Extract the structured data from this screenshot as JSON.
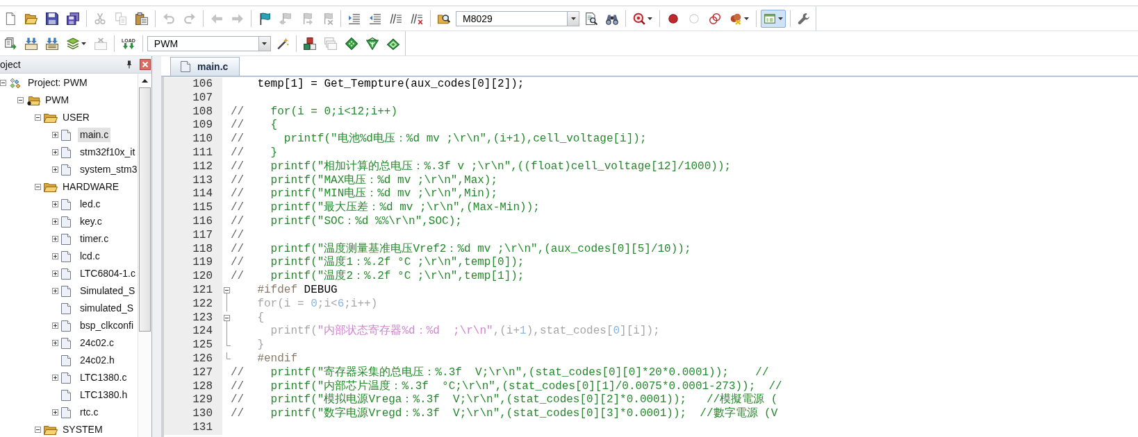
{
  "toolbars": [
    {
      "items": [
        {
          "kind": "new",
          "disabled": false,
          "pressed": false
        },
        {
          "kind": "open",
          "disabled": false,
          "pressed": false
        },
        {
          "kind": "save",
          "disabled": false,
          "pressed": false
        },
        {
          "kind": "saveall",
          "disabled": false,
          "pressed": false
        },
        {
          "kind": "sep"
        },
        {
          "kind": "cut",
          "disabled": true,
          "pressed": false
        },
        {
          "kind": "copy",
          "disabled": true,
          "pressed": false
        },
        {
          "kind": "paste",
          "disabled": false,
          "pressed": false
        },
        {
          "kind": "sep"
        },
        {
          "kind": "undo",
          "disabled": true,
          "pressed": false
        },
        {
          "kind": "redo",
          "disabled": true,
          "pressed": false
        },
        {
          "kind": "sep"
        },
        {
          "kind": "back",
          "disabled": true,
          "pressed": false
        },
        {
          "kind": "forward",
          "disabled": true,
          "pressed": false
        },
        {
          "kind": "sep"
        },
        {
          "kind": "bookmark",
          "disabled": false,
          "pressed": false
        },
        {
          "kind": "prevmark",
          "disabled": true,
          "pressed": false
        },
        {
          "kind": "nextmark",
          "disabled": true,
          "pressed": false
        },
        {
          "kind": "clearmarks",
          "disabled": true,
          "pressed": false
        },
        {
          "kind": "sep"
        },
        {
          "kind": "indent",
          "disabled": false,
          "pressed": false
        },
        {
          "kind": "outdent",
          "disabled": false,
          "pressed": false
        },
        {
          "kind": "comment",
          "disabled": false,
          "pressed": false
        },
        {
          "kind": "uncomment",
          "disabled": false,
          "pressed": false
        },
        {
          "kind": "sep"
        },
        {
          "kind": "findfiles",
          "disabled": false,
          "pressed": false
        },
        {
          "kind": "combo",
          "value": "M8029"
        },
        {
          "kind": "find",
          "disabled": false,
          "pressed": false
        },
        {
          "kind": "incfind",
          "disabled": false,
          "pressed": false
        },
        {
          "kind": "sep"
        },
        {
          "kind": "debug",
          "disabled": false,
          "pressed": false,
          "menu": true
        },
        {
          "kind": "sep"
        },
        {
          "kind": "breakpoint",
          "disabled": false,
          "pressed": false
        },
        {
          "kind": "bpdisable",
          "disabled": true,
          "pressed": false
        },
        {
          "kind": "bpdisableall",
          "disabled": false,
          "pressed": false
        },
        {
          "kind": "bpkillall",
          "disabled": false,
          "pressed": false,
          "menu": true
        },
        {
          "kind": "sep"
        },
        {
          "kind": "windows",
          "disabled": false,
          "pressed": true,
          "menu": true
        },
        {
          "kind": "sep"
        },
        {
          "kind": "config",
          "disabled": false,
          "pressed": false
        }
      ]
    },
    {
      "items": [
        {
          "kind": "translate",
          "disabled": false,
          "pressed": false
        },
        {
          "kind": "build",
          "disabled": false,
          "pressed": false
        },
        {
          "kind": "rebuild",
          "disabled": false,
          "pressed": false
        },
        {
          "kind": "batch",
          "disabled": false,
          "pressed": false,
          "menu": true
        },
        {
          "kind": "stop",
          "disabled": true,
          "pressed": false
        },
        {
          "kind": "sep"
        },
        {
          "kind": "download",
          "disabled": false,
          "pressed": false,
          "label": "LOAD"
        },
        {
          "kind": "sep"
        },
        {
          "kind": "combo",
          "value": "PWM"
        },
        {
          "kind": "options",
          "disabled": false,
          "pressed": false
        },
        {
          "kind": "sep"
        },
        {
          "kind": "components",
          "disabled": false,
          "pressed": false
        },
        {
          "kind": "packs",
          "disabled": true,
          "pressed": false
        },
        {
          "kind": "select",
          "disabled": false,
          "pressed": false
        },
        {
          "kind": "fork",
          "disabled": false,
          "pressed": false
        },
        {
          "kind": "stack",
          "disabled": false,
          "pressed": false
        }
      ]
    }
  ],
  "project_panel": {
    "title": "oject",
    "tree": [
      {
        "label": "Project: PWM",
        "kind": "project",
        "expanded": true,
        "selected": false,
        "children": [
          {
            "label": "PWM",
            "kind": "target",
            "expanded": true,
            "selected": false,
            "children": [
              {
                "label": "USER",
                "kind": "group",
                "expanded": true,
                "selected": false,
                "children": [
                  {
                    "label": "main.c",
                    "kind": "file",
                    "expanded": false,
                    "selected": true
                  },
                  {
                    "label": "stm32f10x_it",
                    "kind": "file",
                    "expanded": false,
                    "selected": false
                  },
                  {
                    "label": "system_stm3",
                    "kind": "file",
                    "expanded": false,
                    "selected": false
                  }
                ]
              },
              {
                "label": "HARDWARE",
                "kind": "group",
                "expanded": true,
                "selected": false,
                "children": [
                  {
                    "label": "led.c",
                    "kind": "file",
                    "expanded": false,
                    "selected": false
                  },
                  {
                    "label": "key.c",
                    "kind": "file",
                    "expanded": false,
                    "selected": false
                  },
                  {
                    "label": "timer.c",
                    "kind": "file",
                    "expanded": false,
                    "selected": false
                  },
                  {
                    "label": "lcd.c",
                    "kind": "file",
                    "expanded": false,
                    "selected": false
                  },
                  {
                    "label": "LTC6804-1.c",
                    "kind": "file",
                    "expanded": false,
                    "selected": false
                  },
                  {
                    "label": "Simulated_S",
                    "kind": "file",
                    "expanded": false,
                    "selected": false
                  },
                  {
                    "label": "simulated_S",
                    "kind": "file",
                    "selected": false
                  },
                  {
                    "label": "bsp_clkconfi",
                    "kind": "file",
                    "expanded": false,
                    "selected": false
                  },
                  {
                    "label": "24c02.c",
                    "kind": "file",
                    "expanded": false,
                    "selected": false
                  },
                  {
                    "label": "24c02.h",
                    "kind": "file",
                    "selected": false
                  },
                  {
                    "label": "LTC1380.c",
                    "kind": "file",
                    "expanded": false,
                    "selected": false
                  },
                  {
                    "label": "LTC1380.h",
                    "kind": "file",
                    "selected": false
                  },
                  {
                    "label": "rtc.c",
                    "kind": "file",
                    "expanded": false,
                    "selected": false
                  }
                ]
              },
              {
                "label": "SYSTEM",
                "kind": "group",
                "expanded": true,
                "selected": false
              }
            ]
          }
        ]
      }
    ]
  },
  "editor": {
    "tabs": [
      {
        "label": "main.c",
        "selected": true
      }
    ],
    "lines": [
      {
        "number": "106",
        "kind": "code",
        "segments": [
          {
            "kind": "plain",
            "text": "    temp[1] = Get_Tempture(aux_codes[0][2]);"
          }
        ]
      },
      {
        "number": "107",
        "kind": "code"
      },
      {
        "number": "108",
        "kind": "code",
        "segments": [
          {
            "kind": "mark",
            "text": "//"
          },
          {
            "kind": "comment",
            "text": "    for(i = 0;i<12;i++)"
          }
        ]
      },
      {
        "number": "109",
        "kind": "code",
        "segments": [
          {
            "kind": "mark",
            "text": "//"
          },
          {
            "kind": "comment",
            "text": "    {"
          }
        ]
      },
      {
        "number": "110",
        "kind": "code",
        "segments": [
          {
            "kind": "mark",
            "text": "//"
          },
          {
            "kind": "comment",
            "text": "      printf(\"电池%d电压：%d mv ;\\r\\n\",(i+1),cell_voltage[i]);"
          }
        ]
      },
      {
        "number": "111",
        "kind": "code",
        "segments": [
          {
            "kind": "mark",
            "text": "//"
          },
          {
            "kind": "comment",
            "text": "    }"
          }
        ]
      },
      {
        "number": "112",
        "kind": "code",
        "segments": [
          {
            "kind": "mark",
            "text": "//"
          },
          {
            "kind": "comment",
            "text": "    printf(\"相加计算的总电压：%.3f v ;\\r\\n\",((float)cell_voltage[12]/1000));"
          }
        ]
      },
      {
        "number": "113",
        "kind": "code",
        "segments": [
          {
            "kind": "mark",
            "text": "//"
          },
          {
            "kind": "comment",
            "text": "    printf(\"MAX电压：%d mv ;\\r\\n\",Max);"
          }
        ]
      },
      {
        "number": "114",
        "kind": "code",
        "segments": [
          {
            "kind": "mark",
            "text": "//"
          },
          {
            "kind": "comment",
            "text": "    printf(\"MIN电压：%d mv ;\\r\\n\",Min);"
          }
        ]
      },
      {
        "number": "115",
        "kind": "code",
        "segments": [
          {
            "kind": "mark",
            "text": "//"
          },
          {
            "kind": "comment",
            "text": "    printf(\"最大压差：%d mv ;\\r\\n\",(Max-Min));"
          }
        ]
      },
      {
        "number": "116",
        "kind": "code",
        "segments": [
          {
            "kind": "mark",
            "text": "//"
          },
          {
            "kind": "comment",
            "text": "    printf(\"SOC：%d %%\\r\\n\",SOC);"
          }
        ]
      },
      {
        "number": "117",
        "kind": "code",
        "segments": [
          {
            "kind": "mark",
            "text": "//"
          }
        ]
      },
      {
        "number": "118",
        "kind": "code",
        "segments": [
          {
            "kind": "mark",
            "text": "//"
          },
          {
            "kind": "comment",
            "text": "    printf(\"温度测量基准电压Vref2：%d mv ;\\r\\n\",(aux_codes[0][5]/10));"
          }
        ]
      },
      {
        "number": "119",
        "kind": "code",
        "segments": [
          {
            "kind": "mark",
            "text": "//"
          },
          {
            "kind": "comment",
            "text": "    printf(\"温度1：%.2f °C ;\\r\\n\",temp[0]);"
          }
        ]
      },
      {
        "number": "120",
        "kind": "code",
        "segments": [
          {
            "kind": "mark",
            "text": "//"
          },
          {
            "kind": "comment",
            "text": "    printf(\"温度2：%.2f °C ;\\r\\n\",temp[1]);"
          }
        ]
      },
      {
        "number": "121",
        "kind": "foldstart",
        "expanded": true,
        "segments": [
          {
            "kind": "directive",
            "text": "    #ifdef"
          },
          {
            "kind": "plain",
            "text": " DEBUG"
          }
        ]
      },
      {
        "number": "122",
        "kind": "foldbody",
        "segments": [
          {
            "kind": "inactive",
            "text": "    for(i = "
          },
          {
            "kind": "number",
            "text": "0"
          },
          {
            "kind": "inactive",
            "text": ";i<"
          },
          {
            "kind": "number",
            "text": "6"
          },
          {
            "kind": "inactive",
            "text": ";i++)"
          }
        ]
      },
      {
        "number": "123",
        "kind": "foldstart",
        "expanded": true,
        "segments": [
          {
            "kind": "inactive",
            "text": "    {"
          }
        ]
      },
      {
        "number": "124",
        "kind": "foldbody",
        "segments": [
          {
            "kind": "inactive",
            "text": "      printf("
          },
          {
            "kind": "string",
            "text": "\"内部状态寄存器%d：%d  ;\\r\\n\""
          },
          {
            "kind": "inactive",
            "text": ",(i+"
          },
          {
            "kind": "number",
            "text": "1"
          },
          {
            "kind": "inactive",
            "text": "),stat_codes["
          },
          {
            "kind": "number",
            "text": "0"
          },
          {
            "kind": "inactive",
            "text": "][i]);"
          }
        ]
      },
      {
        "number": "125",
        "kind": "foldend",
        "segments": [
          {
            "kind": "inactive",
            "text": "    }"
          }
        ]
      },
      {
        "number": "126",
        "kind": "foldend",
        "segments": [
          {
            "kind": "directive",
            "text": "    #endif"
          }
        ]
      },
      {
        "number": "127",
        "kind": "code",
        "segments": [
          {
            "kind": "mark",
            "text": "//"
          },
          {
            "kind": "comment",
            "text": "    printf(\"寄存器采集的总电压：%.3f  V;\\r\\n\",(stat_codes[0][0]*20*0.0001));    //"
          }
        ]
      },
      {
        "number": "128",
        "kind": "code",
        "segments": [
          {
            "kind": "mark",
            "text": "//"
          },
          {
            "kind": "comment",
            "text": "    printf(\"内部芯片温度：%.3f  °C;\\r\\n\",(stat_codes[0][1]/0.0075*0.0001-273));  //"
          }
        ]
      },
      {
        "number": "129",
        "kind": "code",
        "segments": [
          {
            "kind": "mark",
            "text": "//"
          },
          {
            "kind": "comment",
            "text": "    printf(\"模拟电源Vrega：%.3f  V;\\r\\n\",(stat_codes[0][2]*0.0001));   //模擬電源 ("
          }
        ]
      },
      {
        "number": "130",
        "kind": "code",
        "segments": [
          {
            "kind": "mark",
            "text": "//"
          },
          {
            "kind": "comment",
            "text": "    printf(\"数字电源Vregd：%.3f  V;\\r\\n\",(stat_codes[0][3]*0.0001));  //數字電源 (V"
          }
        ]
      },
      {
        "number": "131",
        "kind": "code"
      }
    ]
  }
}
